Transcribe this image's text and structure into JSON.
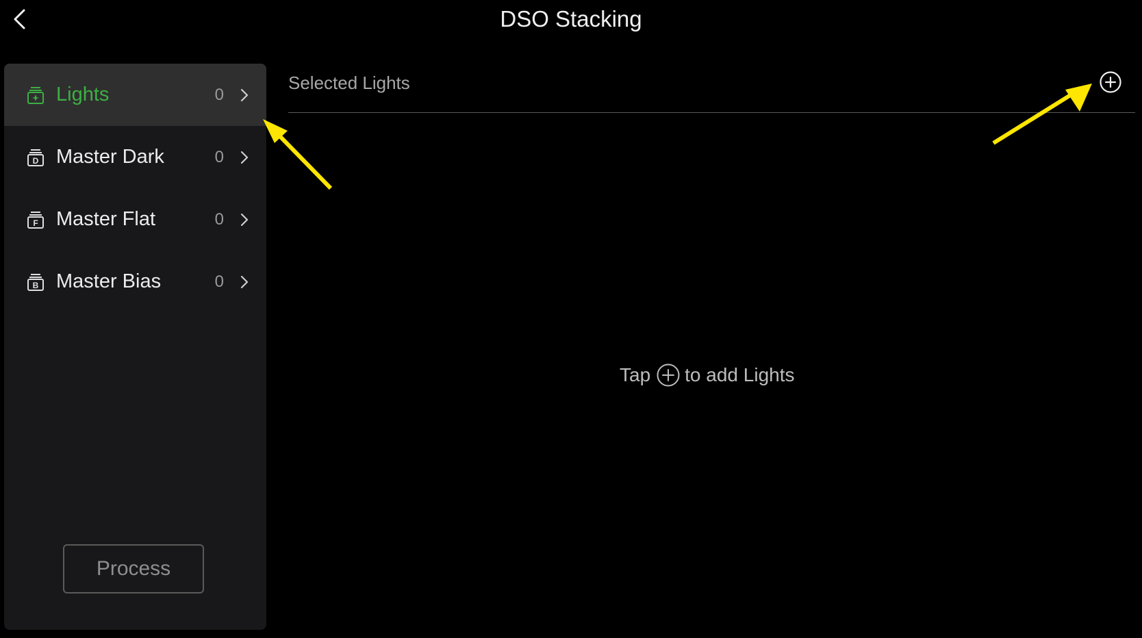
{
  "header": {
    "title": "DSO Stacking",
    "back_icon": "chevron-left-icon"
  },
  "sidebar": {
    "items": [
      {
        "label": "Lights",
        "count": "0",
        "icon": "lights-stack-icon",
        "active": true
      },
      {
        "label": "Master Dark",
        "count": "0",
        "icon": "stack-d-icon",
        "active": false
      },
      {
        "label": "Master Flat",
        "count": "0",
        "icon": "stack-f-icon",
        "active": false
      },
      {
        "label": "Master Bias",
        "count": "0",
        "icon": "stack-b-icon",
        "active": false
      }
    ],
    "process_label": "Process"
  },
  "content": {
    "title": "Selected Lights",
    "add_icon": "plus-circle-icon",
    "empty_hint_before": "Tap",
    "empty_hint_after": "to add Lights"
  },
  "colors": {
    "accent_green": "#3cb043",
    "annotation_yellow": "#ffe600",
    "background": "#000000",
    "sidebar_bg": "#18181b",
    "active_item_bg": "#2f2f2f"
  }
}
